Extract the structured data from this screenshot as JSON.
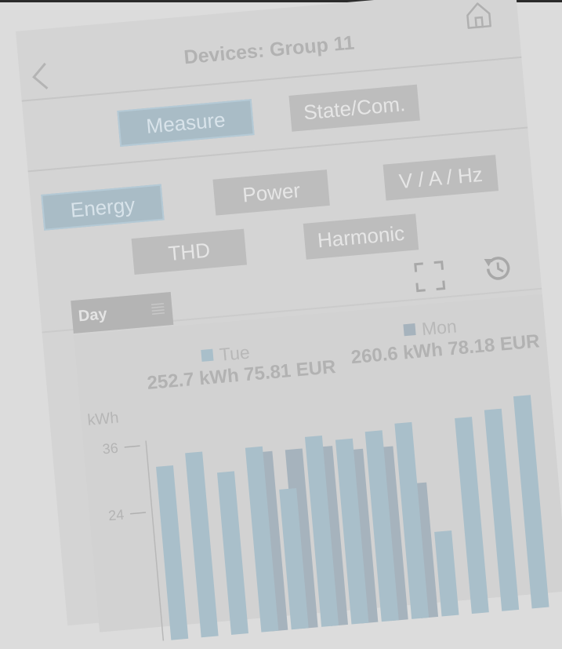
{
  "header": {
    "title": "Devices: Group 11"
  },
  "tabs": {
    "measure": "Measure",
    "state": "State/Com."
  },
  "subtabs": {
    "energy": "Energy",
    "power": "Power",
    "vahz": "V / A / Hz",
    "thd": "THD",
    "harmonic": "Harmonic"
  },
  "period": {
    "selected": "Day"
  },
  "legend": {
    "tue_label": "Tue",
    "tue_total": "252.7 kWh 75.81 EUR",
    "mon_label": "Mon",
    "mon_total": "260.6 kWh 78.18 EUR"
  },
  "colors": {
    "tue": "#a9bfca",
    "mon": "#a6b3bd",
    "active": "#a9bcc6"
  },
  "chart_data": {
    "type": "bar",
    "ylabel": "kWh",
    "ylim": [
      0,
      36
    ],
    "yticks": [
      24,
      36
    ],
    "series": [
      {
        "name": "Tue",
        "values": [
          32,
          34,
          30,
          34,
          26,
          35,
          34,
          35,
          36,
          16,
          36,
          37,
          39
        ]
      },
      {
        "name": "Mon",
        "values": [
          0,
          0,
          0,
          33,
          33,
          33,
          32,
          32,
          25,
          0,
          0,
          0,
          0
        ]
      }
    ]
  }
}
